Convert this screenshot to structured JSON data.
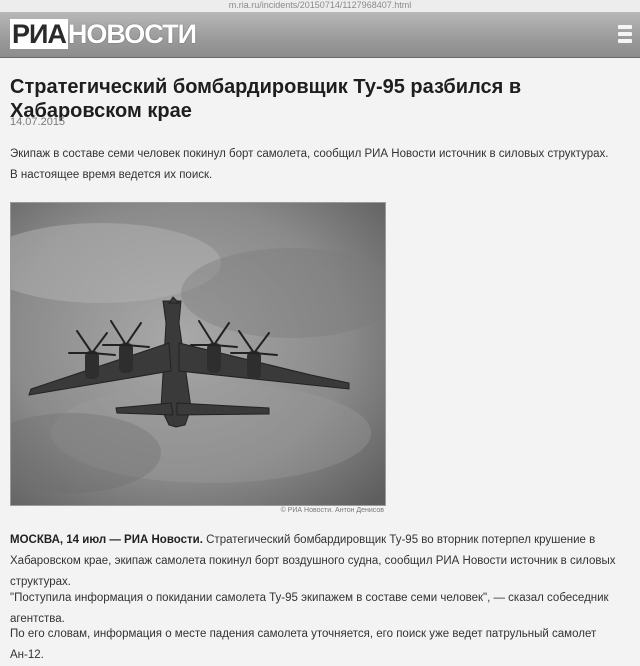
{
  "browser": {
    "url": "m.ria.ru/incidents/20150714/1127968407.html"
  },
  "header": {
    "logo_ria": "РИА",
    "logo_rest": "НОВОСТИ"
  },
  "article": {
    "title": "Стратегический бомбардировщик Ту-95 разбился в Хабаровском крае",
    "date": "14.07.2015",
    "lead": "Экипаж в составе семи человек покинул борт самолета, сообщил РИА Новости источник в силовых структурах. В настоящее время ведется их поиск.",
    "photo_caption": "© РИА Новости. Антон Денисов",
    "p1_lead": "МОСКВА, 14 июл — РИА Новости.",
    "p1_text": " Стратегический бомбардировщик Ту-95 во вторник потерпел крушение в Хабаровском крае, экипаж самолета покинул борт воздушного судна, сообщил РИА Новости источник в силовых структурах.",
    "p2_text": "\"Поступила информация о покидании самолета Ту-95 экипажем в составе семи человек\", — сказал собеседник агентства.",
    "p3_text": "По его словам, информация о месте падения самолета уточняется, его поиск уже ведет патрульный самолет Ан-12."
  },
  "icons": {
    "menu": "hamburger-menu-icon"
  },
  "colors": {
    "header_bg": "#9a9a9a",
    "page_bg": "#f3f3f3",
    "text": "#2a2a2a"
  }
}
